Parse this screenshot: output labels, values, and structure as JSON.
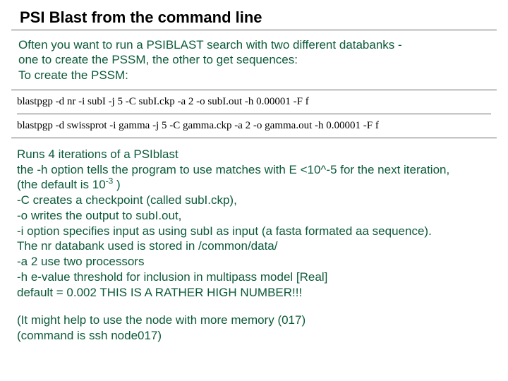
{
  "title": "PSI Blast from the command line",
  "intro": {
    "l1": "Often you want to run a PSIBLAST search with two different databanks -",
    "l2": "one to create the PSSM, the other to get sequences:",
    "l3": "To create the PSSM:"
  },
  "cmd1": "blastpgp -d nr -i subI -j 5 -C subI.ckp -a 2 -o subI.out -h 0.00001 -F f",
  "cmd2": "blastpgp -d swissprot -i gamma -j 5 -C gamma.ckp -a 2 -o gamma.out -h 0.00001 -F f",
  "explain": {
    "l1": " Runs 4 iterations of a PSIblast",
    "l2": "the -h option tells the program to use matches with E <10^-5 for the next iteration,",
    "l3_pre": "   (the default is 10",
    "l3_sup": "-3",
    "l3_post": " )",
    "l4": "-C creates a checkpoint (called subI.ckp),",
    "l5": "-o writes the output to subI.out,",
    "l6": "-i option specifies input as using subI as input (a fasta formated aa sequence).",
    "l7": "The nr databank used is stored in /common/data/",
    "l8": "-a 2 use two processors",
    "l9": "-h  e-value threshold for inclusion in multipass model [Real]",
    "l10": "    default = 0.002  THIS IS A RATHER HIGH NUMBER!!!"
  },
  "note": {
    "l1": "(It might help to use the node with more memory (017)",
    "l2": "(command is ssh node017)"
  }
}
